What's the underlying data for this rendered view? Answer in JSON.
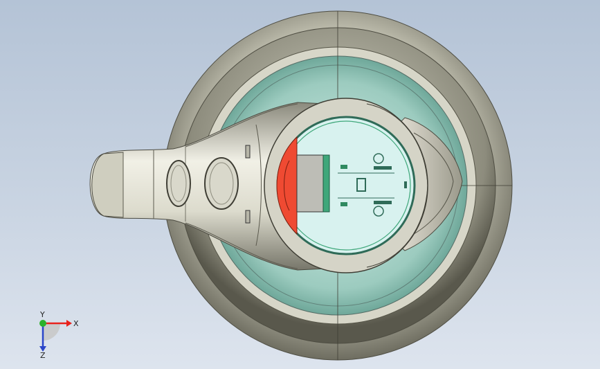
{
  "viewport": {
    "background_top": "#b4c3d6",
    "background_bottom": "#dde4ee"
  },
  "colors": {
    "body_shell": "#c9c8b9",
    "body_shadow": "#6f6e60",
    "inner_cup": "#a9d6cc",
    "inner_face": "#d8f2ef",
    "cut_section": "#ef4a32",
    "green_part": "#3fa77a",
    "grey_block": "#bdbdb6"
  },
  "triad": {
    "x_label": "X",
    "y_label": "Y",
    "z_label": "Z",
    "x_color": "#e8221c",
    "y_color": "#2bb22b",
    "z_color": "#2a45c9"
  }
}
